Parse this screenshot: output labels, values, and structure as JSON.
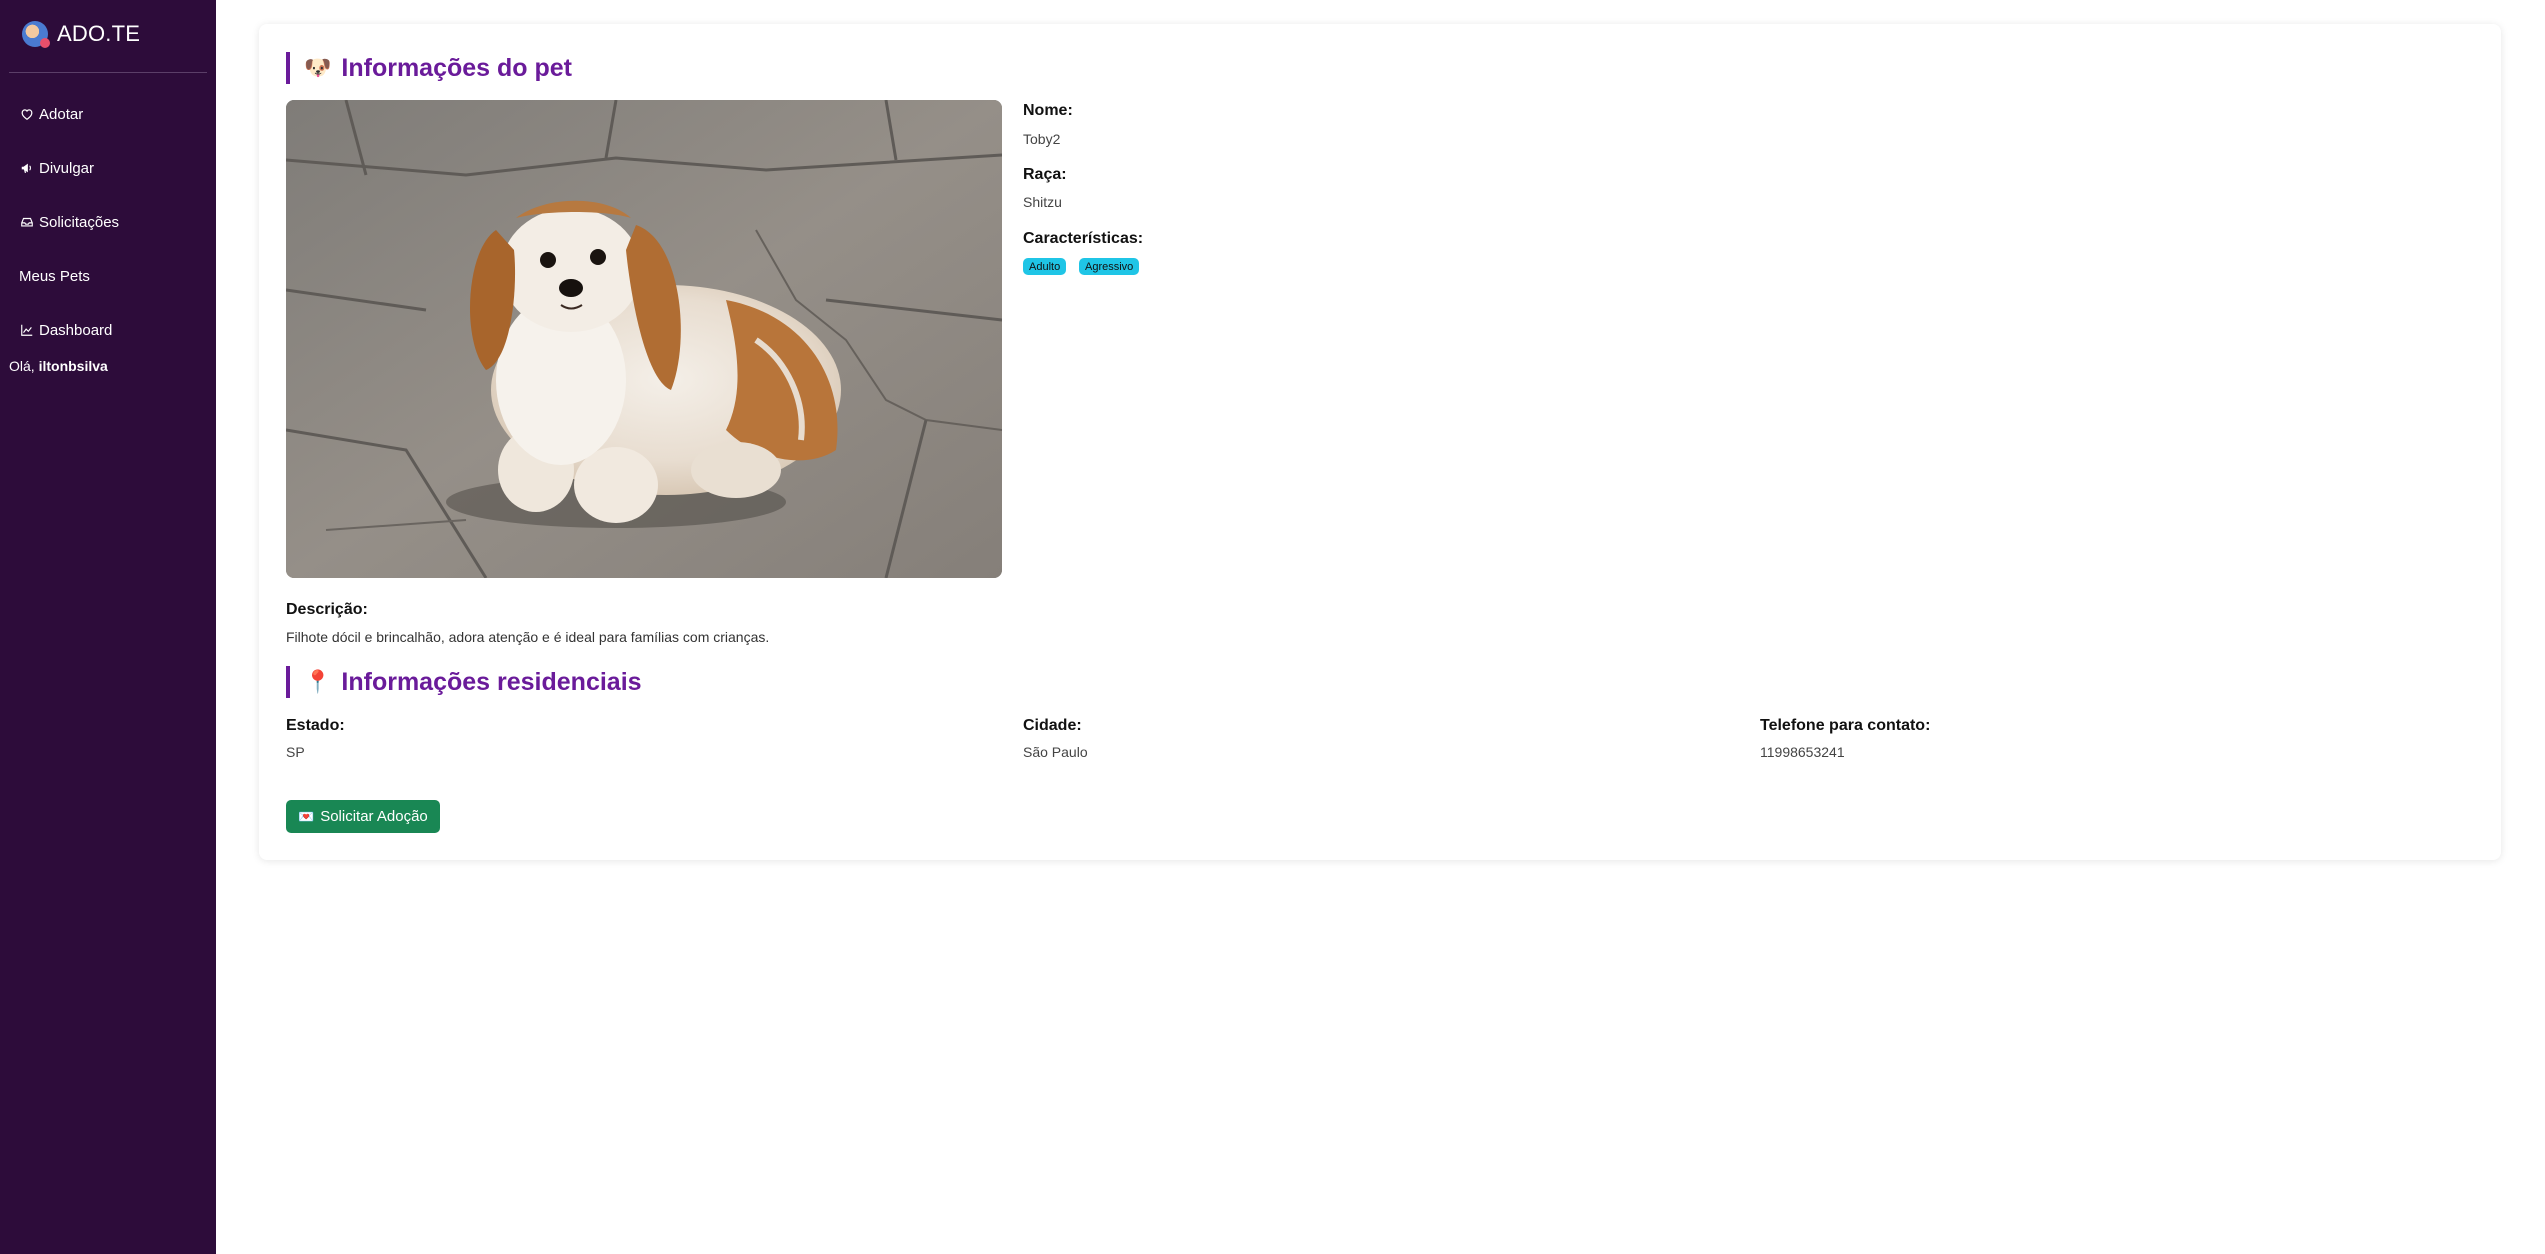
{
  "app": {
    "brand": "ADO.TE",
    "brand_logo_icon": "dog-logo-icon"
  },
  "sidebar": {
    "items": [
      {
        "label": "Adotar",
        "icon": "heart-icon"
      },
      {
        "label": "Divulgar",
        "icon": "megaphone-icon"
      },
      {
        "label": "Solicitações",
        "icon": "inbox-icon"
      },
      {
        "label": "Meus Pets",
        "icon": ""
      },
      {
        "label": "Dashboard",
        "icon": "chart-line-icon"
      }
    ],
    "greeting_prefix": "Olá,",
    "username": "iltonbsilva"
  },
  "pet_section": {
    "title": "Informações do pet",
    "emoji": "🐶",
    "name_label": "Nome:",
    "name_value": "Toby2",
    "breed_label": "Raça:",
    "breed_value": "Shitzu",
    "traits_label": "Características:",
    "traits": [
      "Adulto",
      "Agressivo"
    ],
    "description_label": "Descrição:",
    "description_value": "Filhote dócil e brincalhão, adora atenção e é ideal para famílias com crianças."
  },
  "residence_section": {
    "title": "Informações residenciais",
    "emoji": "📍",
    "state_label": "Estado:",
    "state_value": "SP",
    "city_label": "Cidade:",
    "city_value": "São Paulo",
    "phone_label": "Telefone para contato:",
    "phone_value": "11998653241"
  },
  "actions": {
    "adopt_button_label": "Solicitar Adoção",
    "adopt_button_emoji": "💌"
  },
  "colors": {
    "sidebar_bg": "#2d0c3a",
    "accent": "#6a1b9a",
    "badge": "#1fc5e6",
    "button": "#198754"
  }
}
